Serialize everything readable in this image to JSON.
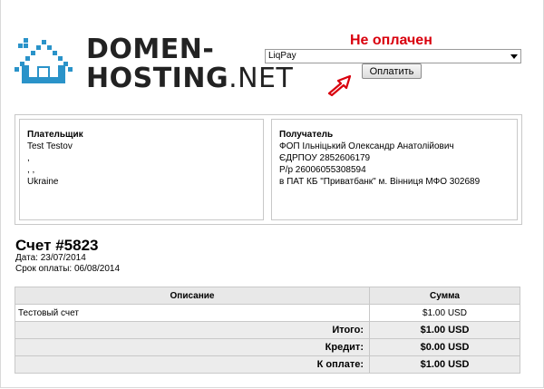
{
  "logo": {
    "line1": "DOMEN-",
    "line2_bold": "HOSTING",
    "line2_rest": ".NET"
  },
  "status": {
    "text": "Не оплачен",
    "color": "#d9000d"
  },
  "payment": {
    "selected_method": "LiqPay",
    "pay_button": "Оплатить"
  },
  "payer": {
    "heading": "Плательщик",
    "lines": [
      "Test Testov",
      ",",
      ", ,",
      "Ukraine"
    ]
  },
  "recipient": {
    "heading": "Получатель",
    "lines": [
      "ФОП Ільніцький Олександр Анатолійович",
      "ЄДРПОУ 2852606179",
      "Р/р 26006055308594",
      "в ПАТ КБ \"Приватбанк\" м. Вінниця МФО 302689"
    ]
  },
  "invoice": {
    "title": "Счет #5823",
    "date": "Дата: 23/07/2014",
    "due": "Срок оплаты: 06/08/2014"
  },
  "table": {
    "headers": {
      "description": "Описание",
      "amount": "Сумма"
    },
    "rows": [
      {
        "description": "Тестовый счет",
        "amount": "$1.00 USD"
      }
    ],
    "totals": [
      {
        "label": "Итого:",
        "value": "$1.00 USD"
      },
      {
        "label": "Кредит:",
        "value": "$0.00 USD"
      },
      {
        "label": "К оплате:",
        "value": "$1.00 USD"
      }
    ]
  }
}
